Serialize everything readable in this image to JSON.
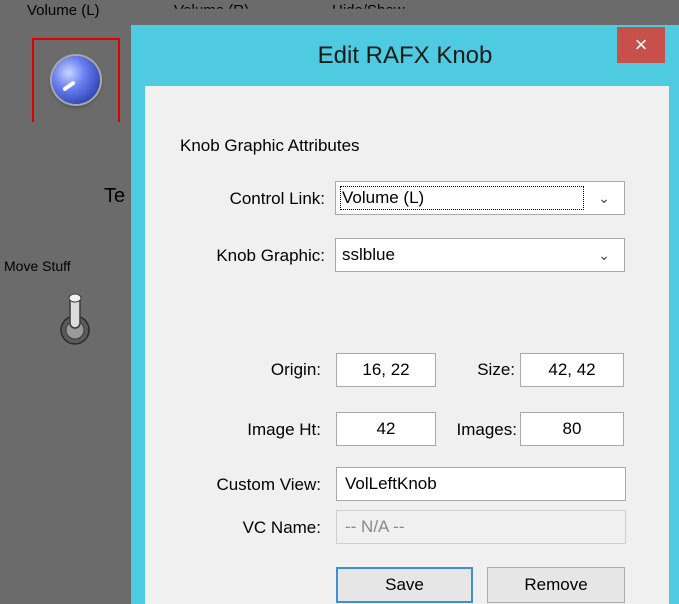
{
  "background": {
    "label_volume_l": "Volume (L)",
    "label_volume_r": "Volume (R)",
    "label_hide_show": "Hide/Show",
    "label_te": "Te",
    "label_move_stuff": "Move Stuff"
  },
  "dialog": {
    "title": "Edit RAFX Knob",
    "close_glyph": "×",
    "section_label": "Knob Graphic Attributes",
    "control_link": {
      "label": "Control Link:",
      "value": "Volume (L)"
    },
    "knob_graphic": {
      "label": "Knob Graphic:",
      "value": "sslblue"
    },
    "origin": {
      "label": "Origin:",
      "value": "16, 22"
    },
    "size": {
      "label": "Size:",
      "value": "42, 42"
    },
    "image_ht": {
      "label": "Image Ht:",
      "value": "42"
    },
    "images": {
      "label": "Images:",
      "value": "80"
    },
    "custom_view": {
      "label": "Custom View:",
      "value": "VolLeftKnob"
    },
    "vc_name": {
      "label": "VC Name:",
      "value": "-- N/A --"
    },
    "save_label": "Save",
    "remove_label": "Remove",
    "dropdown_glyph": "⌄"
  },
  "colors": {
    "title_bar": "#4ecbe0",
    "close_button": "#c7504b",
    "selection_outline": "#e00000"
  }
}
